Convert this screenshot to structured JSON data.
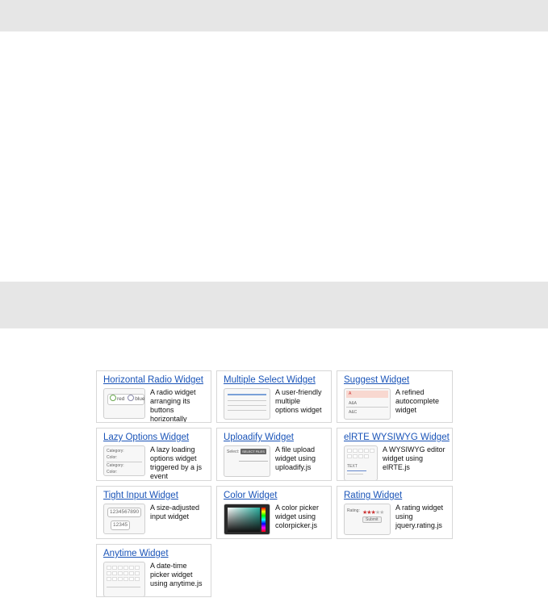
{
  "widgets": [
    {
      "title": "Horizontal Radio Widget",
      "description": "A radio widget arranging its buttons horizontally",
      "icon": "radio-thumbnail-icon",
      "thumb_labels": [
        "red",
        "blue"
      ]
    },
    {
      "title": "Multiple Select Widget",
      "description": "A user-friendly multiple options widget",
      "icon": "multiselect-thumbnail-icon"
    },
    {
      "title": "Suggest Widget",
      "description": "A refined autocomplete widget",
      "icon": "suggest-thumbnail-icon",
      "thumb_labels": [
        "A",
        "A&A",
        "A&C"
      ]
    },
    {
      "title": "Lazy Options Widget",
      "description": "A lazy loading options widget triggered by a js event",
      "icon": "lazy-options-thumbnail-icon",
      "thumb_labels": [
        "Category:",
        "Color:",
        "Category:",
        "Color:"
      ]
    },
    {
      "title": "Uploadify Widget",
      "description": "A file upload widget using uploadify.js",
      "icon": "uploadify-thumbnail-icon",
      "thumb_labels": [
        "Select:",
        "SELECT FILES"
      ]
    },
    {
      "title": "elRTE WYSIWYG Widget",
      "description": "A WYSIWYG editor widget using elRTE.js",
      "icon": "wysiwyg-thumbnail-icon",
      "thumb_labels": [
        "TEXT"
      ]
    },
    {
      "title": "Tight Input Widget",
      "description": "A size-adjusted input widget",
      "icon": "tight-input-thumbnail-icon",
      "thumb_labels": [
        "1234567890",
        "12345"
      ]
    },
    {
      "title": "Color Widget",
      "description": "A color picker widget using colorpicker.js",
      "icon": "color-picker-thumbnail-icon"
    },
    {
      "title": "Rating Widget",
      "description": "A rating widget using jquery.rating.js",
      "icon": "rating-thumbnail-icon",
      "thumb_labels": [
        "Rating:",
        "Submit"
      ]
    },
    {
      "title": "Anytime Widget",
      "description": "A date-time picker widget using anytime.js",
      "icon": "anytime-thumbnail-icon"
    }
  ]
}
